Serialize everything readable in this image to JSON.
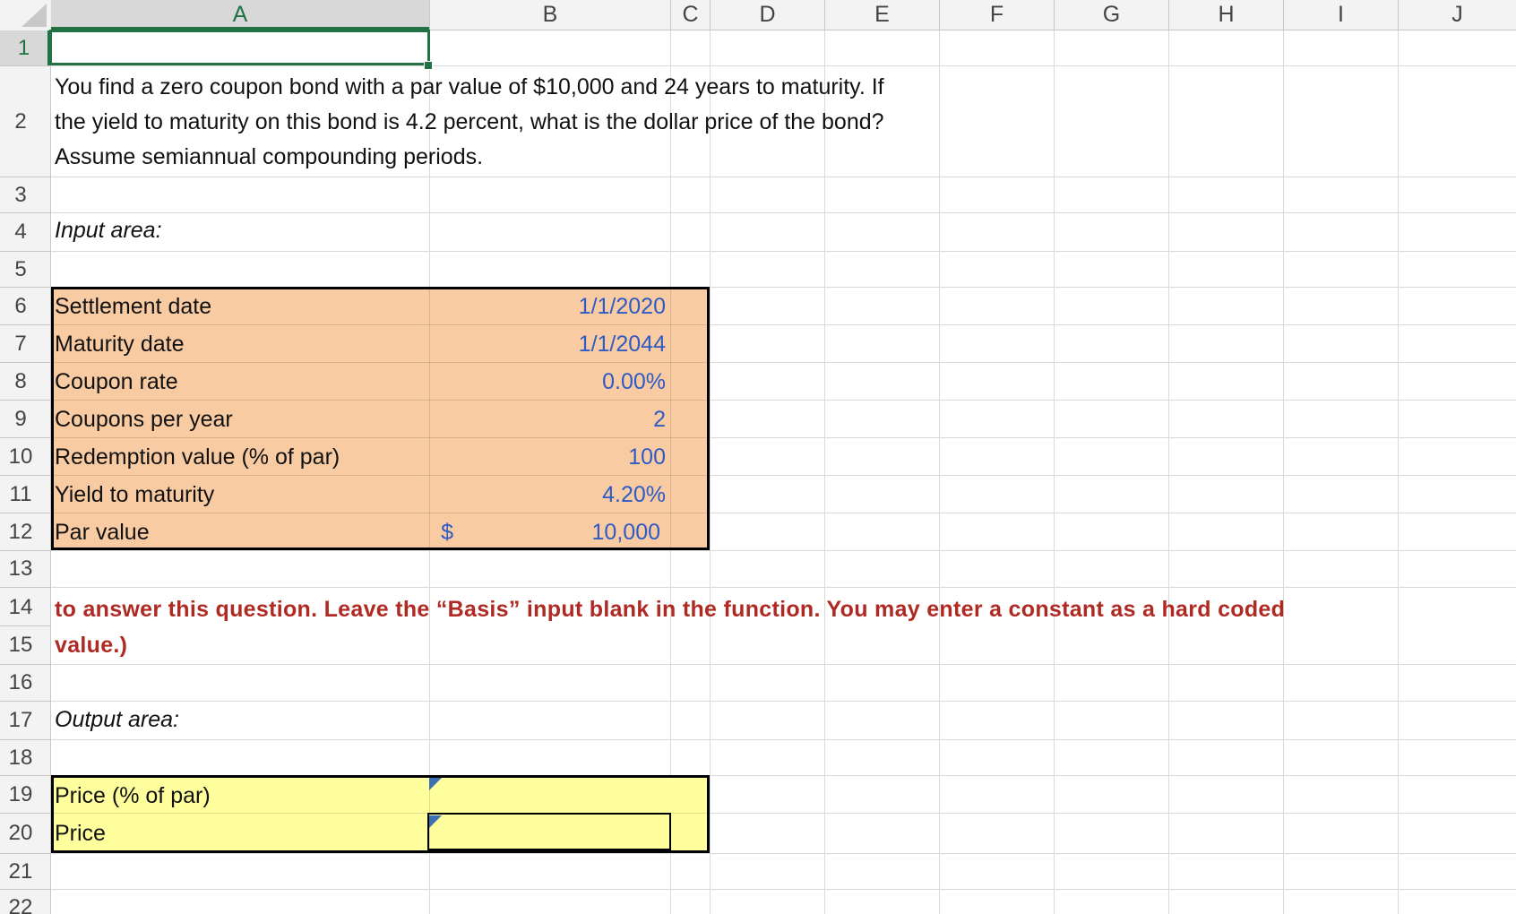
{
  "columns": [
    "A",
    "B",
    "C",
    "D",
    "E",
    "F",
    "G",
    "H",
    "I",
    "J"
  ],
  "rows": [
    "1",
    "2",
    "3",
    "4",
    "5",
    "6",
    "7",
    "8",
    "9",
    "10",
    "11",
    "12",
    "13",
    "14",
    "15",
    "16",
    "17",
    "18",
    "19",
    "20",
    "21",
    "22"
  ],
  "selected_cell": "A1",
  "question": "You find a zero coupon bond with a par value of $10,000 and 24 years to maturity. If the yield to maturity on this bond is 4.2 percent, what is the dollar price of the bond? Assume semiannual compounding periods.",
  "input_area": {
    "label": "Input area:",
    "items": [
      {
        "label": "Settlement date",
        "value": "1/1/2020"
      },
      {
        "label": "Maturity date",
        "value": "1/1/2044"
      },
      {
        "label": "Coupon rate",
        "value": "0.00%"
      },
      {
        "label": "Coupons per year",
        "value": "2"
      },
      {
        "label": "Redemption value (% of par)",
        "value": "100"
      },
      {
        "label": "Yield to maturity",
        "value": "4.20%"
      },
      {
        "label": "Par value",
        "currency": "$",
        "value": "10,000"
      }
    ]
  },
  "instruction": {
    "line1": "to answer this question. Leave the “Basis” input blank in the function. You may enter a constant as a hard coded",
    "line2": "value.)"
  },
  "output_area": {
    "label": "Output area:",
    "items": [
      {
        "label": "Price (% of par)",
        "value": ""
      },
      {
        "label": "Price",
        "value": ""
      }
    ]
  },
  "colors": {
    "input_fill": "#f8cba2",
    "output_fill": "#ffff9e",
    "value_text": "#2e5bc4",
    "instruction_text": "#b02a24",
    "selection": "#217346"
  }
}
